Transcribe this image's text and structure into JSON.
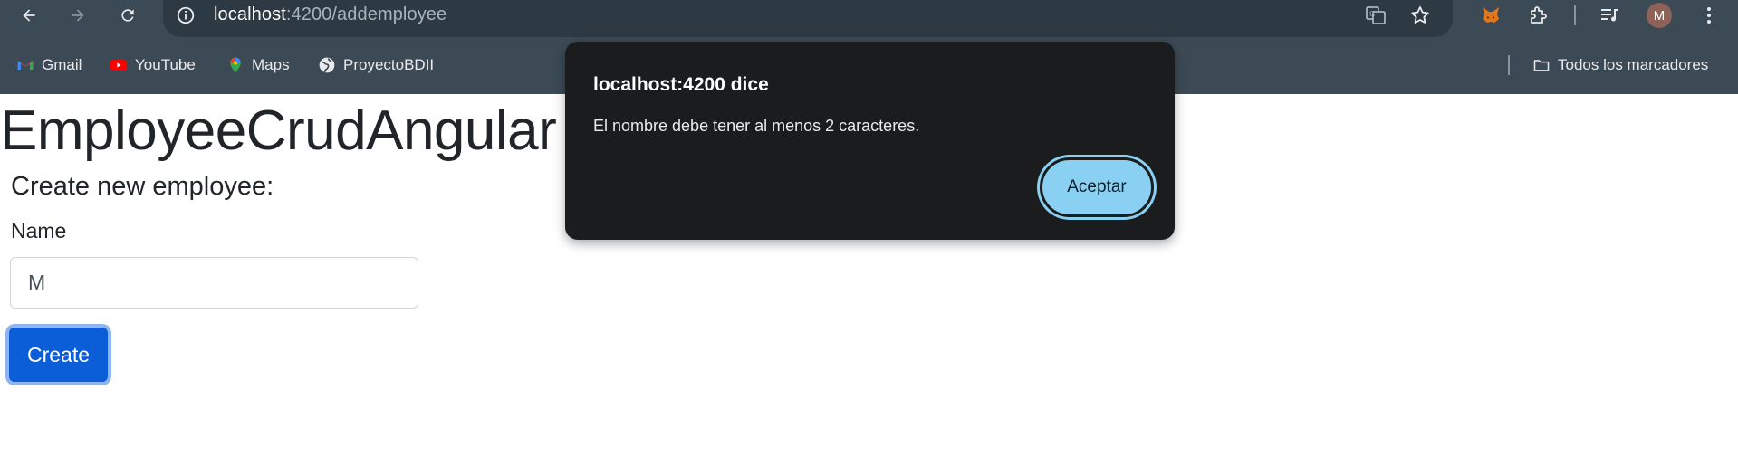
{
  "browser": {
    "url_host": "localhost",
    "url_path": ":4200/addemployee",
    "avatar_letter": "M",
    "icons": {
      "back": "arrow-left-icon",
      "forward": "arrow-right-icon",
      "reload": "reload-icon",
      "site_info": "info-icon",
      "translate": "translate-icon",
      "bookmark_star": "star-icon",
      "metamask": "fox-icon",
      "extensions": "puzzle-icon",
      "media": "media-queue-icon",
      "menu": "kebab-menu-icon"
    },
    "bookmarks": [
      {
        "label": "Gmail",
        "icon": "gmail-icon"
      },
      {
        "label": "YouTube",
        "icon": "youtube-icon"
      },
      {
        "label": "Maps",
        "icon": "maps-pin-icon"
      },
      {
        "label": "ProyectoBDII",
        "icon": "globe-icon"
      }
    ],
    "all_bookmarks": {
      "label": "Todos los marcadores",
      "icon": "folder-icon"
    },
    "colors": {
      "chrome": "#3c4a55",
      "omnibox": "#2e3a43"
    }
  },
  "page": {
    "title": "EmployeeCrudAngular",
    "section_title": "Create new employee:",
    "name_label": "Name",
    "name_value": "M",
    "create_label": "Create",
    "colors": {
      "primary": "#0b5ed7",
      "text": "#212529"
    }
  },
  "dialog": {
    "title": "localhost:4200 dice",
    "message": "El nombre debe tener al menos 2 caracteres.",
    "ok_label": "Aceptar",
    "colors": {
      "background": "#1a1c1e",
      "button": "#8ad0f2"
    }
  }
}
